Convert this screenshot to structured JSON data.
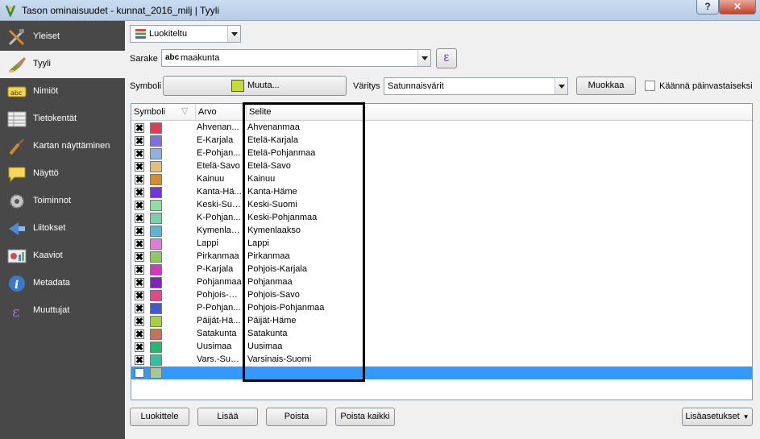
{
  "window": {
    "title": "Tason ominaisuudet - kunnat_2016_milj | Tyyli",
    "help_label": "?",
    "close_label": "✕"
  },
  "sidebar": {
    "items": [
      {
        "label": "Yleiset",
        "icon": "tools-icon",
        "active": false
      },
      {
        "label": "Tyyli",
        "icon": "paintbrush-icon",
        "active": true
      },
      {
        "label": "Nimiöt",
        "icon": "abc-label-icon",
        "active": false
      },
      {
        "label": "Tietokentät",
        "icon": "table-icon",
        "active": false
      },
      {
        "label": "Kartan näyttäminen",
        "icon": "brush-icon",
        "active": false
      },
      {
        "label": "Näyttö",
        "icon": "speech-bubble-icon",
        "active": false
      },
      {
        "label": "Toiminnot",
        "icon": "gear-icon",
        "active": false
      },
      {
        "label": "Liitokset",
        "icon": "join-icon",
        "active": false
      },
      {
        "label": "Kaaviot",
        "icon": "diagram-icon",
        "active": false
      },
      {
        "label": "Metadata",
        "icon": "info-icon",
        "active": false
      },
      {
        "label": "Muuttujat",
        "icon": "variable-icon",
        "active": false
      }
    ]
  },
  "renderer": {
    "type": "Luokiteltu"
  },
  "column": {
    "label": "Sarake",
    "type_badge": "abc",
    "value": "maakunta",
    "expression_button": "ε"
  },
  "symbol": {
    "label": "Symboli",
    "change_button": "Muuta...",
    "color": "#c6dc34"
  },
  "color_ramp": {
    "label": "Väritys",
    "value": "Satunnaisvärit",
    "edit_button": "Muokkaa",
    "invert_label": "Käännä päinvastaiseksi",
    "invert_checked": false
  },
  "table": {
    "headers": [
      "Symboli",
      "Arvo",
      "Selite"
    ],
    "rows": [
      {
        "value": "Ahvenan...",
        "legend": "Ahvenanmaa",
        "color": "#de3e54",
        "checked": true
      },
      {
        "value": "E-Karjala",
        "legend": "Etelä-Karjala",
        "color": "#7f6fe2",
        "checked": true
      },
      {
        "value": "E-Pohjan...",
        "legend": "Etelä-Pohjanmaa",
        "color": "#8fb1de",
        "checked": true
      },
      {
        "value": "Etelä-Savo",
        "legend": "Etelä-Savo",
        "color": "#e2c07c",
        "checked": true
      },
      {
        "value": "Kainuu",
        "legend": "Kainuu",
        "color": "#d98a2c",
        "checked": true
      },
      {
        "value": "Kanta-Hä...",
        "legend": "Kanta-Häme",
        "color": "#7532e0",
        "checked": true
      },
      {
        "value": "Keski-Suomi",
        "legend": "Keski-Suomi",
        "color": "#8ee0a0",
        "checked": true
      },
      {
        "value": "K-Pohjan...",
        "legend": "Keski-Pohjanmaa",
        "color": "#7ad0a8",
        "checked": true
      },
      {
        "value": "Kymenlaa...",
        "legend": "Kymenlaakso",
        "color": "#58b8d2",
        "checked": true
      },
      {
        "value": "Lappi",
        "legend": "Lappi",
        "color": "#e47ad6",
        "checked": true
      },
      {
        "value": "Pirkanmaa",
        "legend": "Pirkanmaa",
        "color": "#90c862",
        "checked": true
      },
      {
        "value": "P-Karjala",
        "legend": "Pohjois-Karjala",
        "color": "#d636c0",
        "checked": true
      },
      {
        "value": "Pohjanmaa",
        "legend": "Pohjanmaa",
        "color": "#8220c4",
        "checked": true
      },
      {
        "value": "Pohjois-S...",
        "legend": "Pohjois-Savo",
        "color": "#e04a8a",
        "checked": true
      },
      {
        "value": "P-Pohjan...",
        "legend": "Pohjois-Pohjanmaa",
        "color": "#3e5ad8",
        "checked": true
      },
      {
        "value": "Päijät-Hä...",
        "legend": "Päijät-Häme",
        "color": "#a6d040",
        "checked": true
      },
      {
        "value": "Satakunta",
        "legend": "Satakunta",
        "color": "#c8705a",
        "checked": true
      },
      {
        "value": "Uusimaa",
        "legend": "Uusimaa",
        "color": "#24b86a",
        "checked": true
      },
      {
        "value": "Vars.-Suomi",
        "legend": "Varsinais-Suomi",
        "color": "#2ec4a2",
        "checked": true
      },
      {
        "value": "",
        "legend": "",
        "color": "#a6c88e",
        "checked": false
      }
    ]
  },
  "buttons": {
    "classify": "Luokittele",
    "add": "Lisää",
    "remove": "Poista",
    "remove_all": "Poista kaikki",
    "advanced": "Lisäasetukset"
  }
}
